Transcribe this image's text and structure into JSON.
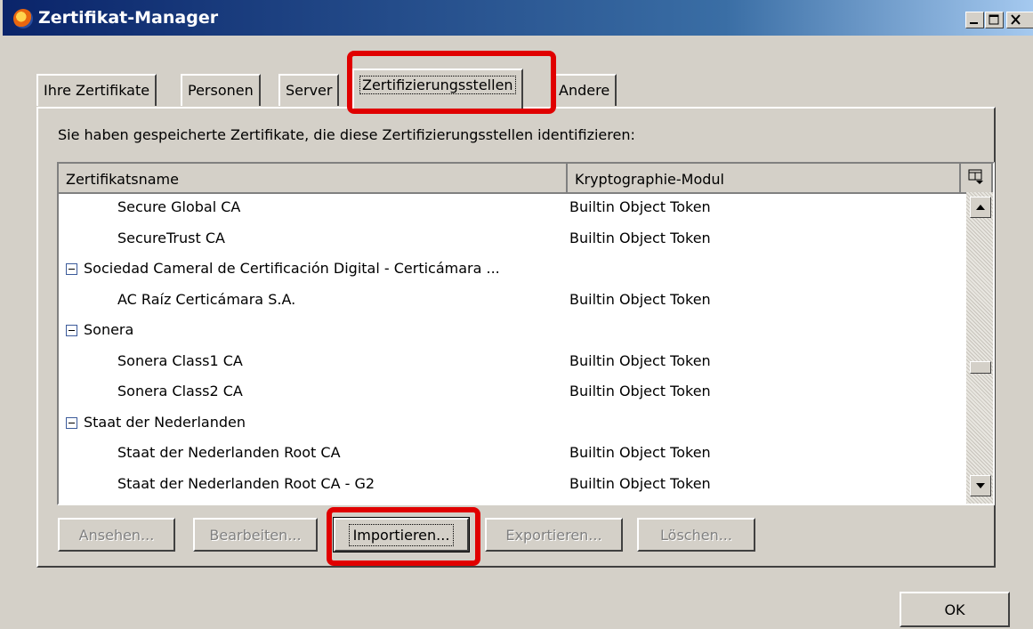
{
  "window": {
    "title": "Zertifikat-Manager"
  },
  "tabs": [
    {
      "label": "Ihre Zertifikate",
      "active": false
    },
    {
      "label": "Personen",
      "active": false
    },
    {
      "label": "Server",
      "active": false
    },
    {
      "label": "Zertifizierungsstellen",
      "active": true
    },
    {
      "label": "Andere",
      "active": false
    }
  ],
  "intro_text": "Sie haben gespeicherte Zertifikate, die diese Zertifizierungsstellen identifizieren:",
  "table": {
    "columns": [
      "Zertifikatsname",
      "Kryptographie-Modul"
    ],
    "rows": [
      {
        "type": "cert",
        "name": "Secure Global CA",
        "module": "Builtin Object Token"
      },
      {
        "type": "cert",
        "name": "SecureTrust CA",
        "module": "Builtin Object Token"
      },
      {
        "type": "group",
        "name": "Sociedad Cameral de Certificación Digital - Certicámara ...",
        "module": ""
      },
      {
        "type": "cert",
        "name": "AC Raíz Certicámara S.A.",
        "module": "Builtin Object Token"
      },
      {
        "type": "group",
        "name": "Sonera",
        "module": ""
      },
      {
        "type": "cert",
        "name": "Sonera Class1 CA",
        "module": "Builtin Object Token"
      },
      {
        "type": "cert",
        "name": "Sonera Class2 CA",
        "module": "Builtin Object Token"
      },
      {
        "type": "group",
        "name": "Staat der Nederlanden",
        "module": ""
      },
      {
        "type": "cert",
        "name": "Staat der Nederlanden Root CA",
        "module": "Builtin Object Token"
      },
      {
        "type": "cert",
        "name": "Staat der Nederlanden Root CA - G2",
        "module": "Builtin Object Token"
      }
    ]
  },
  "buttons": {
    "view": "Ansehen...",
    "edit": "Bearbeiten...",
    "import": "Importieren...",
    "export": "Exportieren...",
    "delete": "Löschen...",
    "ok": "OK"
  },
  "colors": {
    "title_bar": "#0a246a",
    "highlight": "#e00000",
    "face": "#d4d0c8"
  }
}
